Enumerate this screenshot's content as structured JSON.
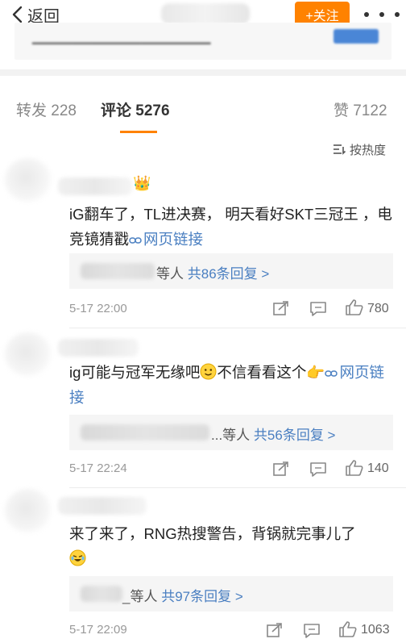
{
  "header": {
    "back_label": "返回",
    "follow_label": "+关注"
  },
  "tabs": {
    "repost": "转发 228",
    "comment": "评论 5276",
    "like": "赞 7122"
  },
  "sort_label": "按热度",
  "comments": [
    {
      "text": "iG翻车了，TL进决赛， 明天看好SKT三冠王 ，电竞镜猜戳",
      "link_label": "网页链接",
      "reply_suffix": "等人",
      "reply_count_label": "共86条回复 >",
      "time": "5-17 22:00",
      "likes": "780"
    },
    {
      "text_before_emoji": "ig可能与冠军无缘吧",
      "text_after_emoji": "不信看看这个",
      "link_label": "网页链接",
      "reply_suffix": "...等人",
      "reply_count_label": "共56条回复 >",
      "time": "5-17 22:24",
      "likes": "140"
    },
    {
      "text": "来了来了，RNG热搜警告，背锅就完事儿了",
      "reply_suffix": "_等人",
      "reply_count_label": "共97条回复 >",
      "time": "5-17 22:09",
      "likes": "1063"
    }
  ],
  "colors": {
    "accent": "#ff8200",
    "link": "#4a7fc1"
  }
}
